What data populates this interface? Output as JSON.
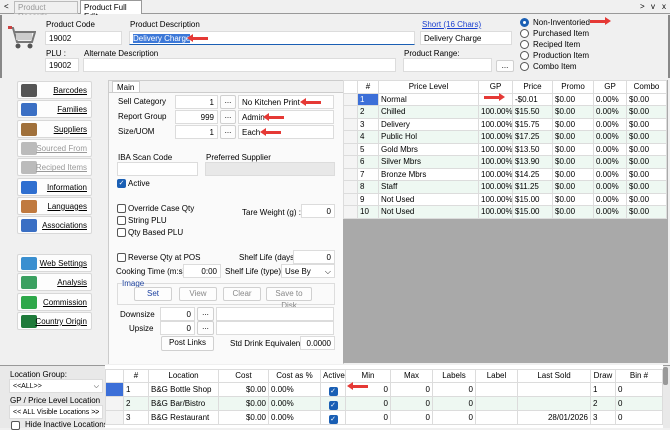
{
  "tabs": [
    {
      "label": "Product Records",
      "active": false
    },
    {
      "label": "Product Full Edit",
      "active": true
    }
  ],
  "window_controls": [
    ">",
    "v",
    "x"
  ],
  "header": {
    "product_code_label": "Product Code",
    "product_code": "19002",
    "description_label": "Product Description",
    "description": "Delivery Charge",
    "short_link": "Short (16 Chars)",
    "short_value": "Delivery Charge",
    "plu_label": "PLU :",
    "plu": "19002",
    "alt_desc_label": "Alternate Description",
    "alt_desc": "",
    "range_label": "Product Range:",
    "range_value": "",
    "ellipsis": "...",
    "item_types": [
      {
        "label": "Non-Inventoried",
        "selected": true
      },
      {
        "label": "Purchased Item",
        "selected": false
      },
      {
        "label": "Reciped Item",
        "selected": false
      },
      {
        "label": "Production Item",
        "selected": false
      },
      {
        "label": "Combo Item",
        "selected": false
      }
    ]
  },
  "sidebar": {
    "buttons": [
      {
        "label": "Barcodes",
        "icon": "barcode-icon",
        "enabled": true,
        "color": "#555"
      },
      {
        "label": "Families",
        "icon": "hierarchy-icon",
        "enabled": true,
        "color": "#3a6fc4"
      },
      {
        "label": "Suppliers",
        "icon": "truck-icon",
        "enabled": true,
        "color": "#a0703a"
      },
      {
        "label": "Sourced From",
        "icon": "glass-icon",
        "enabled": false,
        "color": "#bbb"
      },
      {
        "label": "Reciped Items",
        "icon": "glass-icon",
        "enabled": false,
        "color": "#bbb"
      },
      {
        "label": "Information",
        "icon": "info-icon",
        "enabled": true,
        "color": "#2f6fd0"
      },
      {
        "label": "Languages",
        "icon": "person-icon",
        "enabled": true,
        "color": "#c07a40"
      },
      {
        "label": "Associations",
        "icon": "hierarchy-icon",
        "enabled": true,
        "color": "#3a6fc4"
      },
      {
        "label": "Web Settings",
        "icon": "globe-icon",
        "enabled": true,
        "color": "#3a8fd0"
      },
      {
        "label": "Analysis",
        "icon": "chart-icon",
        "enabled": true,
        "color": "#3aa060"
      },
      {
        "label": "Commission",
        "icon": "dollar-icon",
        "enabled": true,
        "color": "#2ea84a"
      },
      {
        "label": "Country Origin",
        "icon": "australia-flag-icon",
        "enabled": true,
        "color": "#1e7a3a"
      }
    ]
  },
  "main": {
    "tab": "Main",
    "sell_category": {
      "label": "Sell Category",
      "code": "1",
      "name": "No Kitchen Print"
    },
    "report_group": {
      "label": "Report Group",
      "code": "999",
      "name": "Admin"
    },
    "size_uom": {
      "label": "Size/UOM",
      "code": "1",
      "name": "Each"
    },
    "iba_label": "IBA Scan Code",
    "iba_value": "",
    "supplier_label": "Preferred Supplier",
    "supplier_value": "",
    "active_label": "Active",
    "active": true,
    "override_case_qty": {
      "label": "Override Case Qty",
      "checked": false
    },
    "string_plu": {
      "label": "String PLU",
      "checked": false
    },
    "qty_based_plu": {
      "label": "Qty Based PLU",
      "checked": false
    },
    "tare_label": "Tare Weight (g) :",
    "tare_value": "0",
    "reverse_qty": {
      "label": "Reverse Qty at POS",
      "checked": false
    },
    "shelf_days_label": "Shelf Life (days) :",
    "shelf_days": "0",
    "cooking_label": "Cooking Time (m:s):",
    "cooking_value": "0:00",
    "shelf_type_label": "Shelf Life (type) :",
    "shelf_type": "Use By",
    "image_label": "Image",
    "image_buttons": [
      "Set",
      "View",
      "Clear",
      "Save to Disk"
    ],
    "downsize_label": "Downsize",
    "downsize": "0",
    "upsize_label": "Upsize",
    "upsize": "0",
    "post_links": "Post Links",
    "std_drink_label": "Std Drink Equivalent:",
    "std_drink": "0.0000"
  },
  "price_grid": {
    "columns": [
      "#",
      "Price Level",
      "GP",
      "Price",
      "Promo",
      "GP",
      "Combo"
    ],
    "rows": [
      [
        "1",
        "Normal",
        "",
        "-$0.01",
        "$0.00",
        "0.00%",
        "$0.00"
      ],
      [
        "2",
        "Chilled",
        "100.00%",
        "$15.50",
        "$0.00",
        "0.00%",
        "$0.00"
      ],
      [
        "3",
        "Delivery",
        "100.00%",
        "$15.75",
        "$0.00",
        "0.00%",
        "$0.00"
      ],
      [
        "4",
        "Public Hol",
        "100.00%",
        "$17.25",
        "$0.00",
        "0.00%",
        "$0.00"
      ],
      [
        "5",
        "Gold Mbrs",
        "100.00%",
        "$13.50",
        "$0.00",
        "0.00%",
        "$0.00"
      ],
      [
        "6",
        "Silver Mbrs",
        "100.00%",
        "$13.90",
        "$0.00",
        "0.00%",
        "$0.00"
      ],
      [
        "7",
        "Bronze Mbrs",
        "100.00%",
        "$14.25",
        "$0.00",
        "0.00%",
        "$0.00"
      ],
      [
        "8",
        "Staff",
        "100.00%",
        "$11.25",
        "$0.00",
        "0.00%",
        "$0.00"
      ],
      [
        "9",
        "Not Used",
        "100.00%",
        "$15.00",
        "$0.00",
        "0.00%",
        "$0.00"
      ],
      [
        "10",
        "Not Used",
        "100.00%",
        "$15.00",
        "$0.00",
        "0.00%",
        "$0.00"
      ]
    ]
  },
  "location_panel": {
    "group_label": "Location Group:",
    "group_value": "<<ALL>>",
    "gp_label": "GP / Price Level Location",
    "gp_value": "<< ALL Visible Locations >>",
    "hide_inactive": "Hide Inactive Locations"
  },
  "location_grid": {
    "columns": [
      "#",
      "Location",
      "Cost",
      "Cost as %",
      "Active",
      "Min",
      "Max",
      "Labels",
      "Label",
      "Last Sold",
      "Draw",
      "Bin #"
    ],
    "rows": [
      [
        "1",
        "B&G Bottle Shop",
        "$0.00",
        "0.00%",
        true,
        "0",
        "0",
        "0",
        "",
        "",
        "1",
        "0"
      ],
      [
        "2",
        "B&G Bar/Bistro",
        "$0.00",
        "0.00%",
        true,
        "0",
        "0",
        "0",
        "",
        "",
        "2",
        "0"
      ],
      [
        "3",
        "B&G Restaurant",
        "$0.00",
        "0.00%",
        true,
        "0",
        "0",
        "0",
        "",
        "28/01/2026",
        "3",
        "0"
      ]
    ]
  }
}
